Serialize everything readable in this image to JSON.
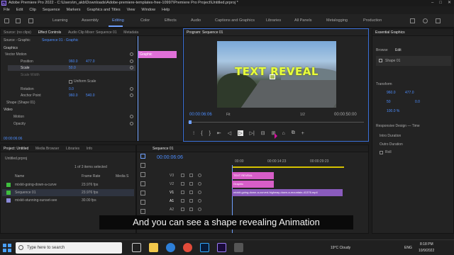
{
  "window": {
    "title": "Adobe Premiere Pro 2022 - C:\\Users\\m_akb\\Downloads\\Adobe-premiere-templates-free-10997\\Premiere Pro Project\\Untitled.prproj *",
    "app_badge": "Pr",
    "controls": [
      "–",
      "□",
      "✕"
    ]
  },
  "menu": [
    "File",
    "Edit",
    "Clip",
    "Sequence",
    "Markers",
    "Graphics and Titles",
    "View",
    "Window",
    "Help"
  ],
  "workspaces": [
    "Learning",
    "Assembly",
    "Editing",
    "Color",
    "Effects",
    "Audio",
    "Captions and Graphics",
    "Libraries",
    "All Panels",
    "Metalogging",
    "Production"
  ],
  "effect_controls": {
    "tabs": [
      "Source: (no clips)",
      "Effect Controls",
      "Audio Clip Mixer: Sequence 01",
      "Metadata"
    ],
    "source_label": "Source - Graphic",
    "seq_label": "Sequence 01 - Graphic",
    "section_graphics": "Graphics",
    "vector_motion": "Vector Motion",
    "position_label": "Position",
    "position_x": "960.0",
    "position_y": "477.0",
    "scale_label": "Scale",
    "scale_value": "50.0",
    "scale_width_label": "Scale Width",
    "uniform_label": "Uniform Scale",
    "rotation_label": "Rotation",
    "rotation_value": "0.0",
    "anchor_label": "Anchor Point",
    "anchor_x": "960.0",
    "anchor_y": "540.0",
    "shape_label": "Shape (Shape 01)",
    "video_label": "Video",
    "motion_label": "Motion",
    "opacity_label": "Opacity",
    "timecode": "00:00:06:06",
    "clip_label": "Graphic"
  },
  "program": {
    "tab": "Program: Sequence 01",
    "video_text": "TEXT REVEAL",
    "timecode_current": "00:00:06:06",
    "fit": "Fit",
    "fraction": "1/2",
    "timecode_total": "00:00:50:00",
    "controls": [
      "⁝",
      "{",
      "}",
      "⇤",
      "◁",
      "▷",
      "▷|",
      "⊟",
      "⊞",
      "⌂",
      "⧉",
      "+"
    ]
  },
  "project": {
    "tabs": [
      "Project: Untitled",
      "Media Browser",
      "Libraries",
      "Info"
    ],
    "file": "Untitled.prproj",
    "selection": "1 of 3 items selected",
    "headers": [
      "Name",
      "Frame Rate",
      "Media S"
    ],
    "rows": [
      {
        "name": "mixkit-going-down-a-curve",
        "rate": "23.976 fps",
        "color": "#3fbf3f"
      },
      {
        "name": "Sequence 01",
        "rate": "23.976 fps",
        "color": "#3fbf3f"
      },
      {
        "name": "mixkit-stunning-sunset-see",
        "rate": "30.00 fps",
        "color": "#8a8ad8"
      }
    ]
  },
  "timeline": {
    "tab": "Sequence 01",
    "timecode": "00:00:06:06",
    "ruler": [
      "00:00",
      "00:00:14:23",
      "00:00:29:23"
    ],
    "tracks": [
      "V3",
      "V2",
      "V1",
      "A1",
      "A2",
      "A3"
    ],
    "clips": {
      "v3": "TEXT REVEAL",
      "v2": "Graphic",
      "v1": "mixkit-going-down-a-curved-highway-down-a-mountain-41376.mp4"
    }
  },
  "essential_graphics": {
    "tab": "Essential Graphics",
    "subtabs": [
      "Browse",
      "Edit"
    ],
    "layer": "Shape 01",
    "transform_label": "Transform",
    "pos_x": "960.0",
    "pos_y": "477.0",
    "scale": "50",
    "rot": "0.0",
    "opacity": "100.0 %",
    "responsive": "Responsive Design — Time",
    "intro": "Intro Duration",
    "outro": "Outro Duration",
    "roll": "Roll"
  },
  "caption": "And you can see a shape revealing Animation",
  "taskbar": {
    "search": "Type here to search",
    "weather": "19°C  Cloudy",
    "lang": "ENG",
    "time": "8:18 PM",
    "date": "10/9/2022"
  }
}
